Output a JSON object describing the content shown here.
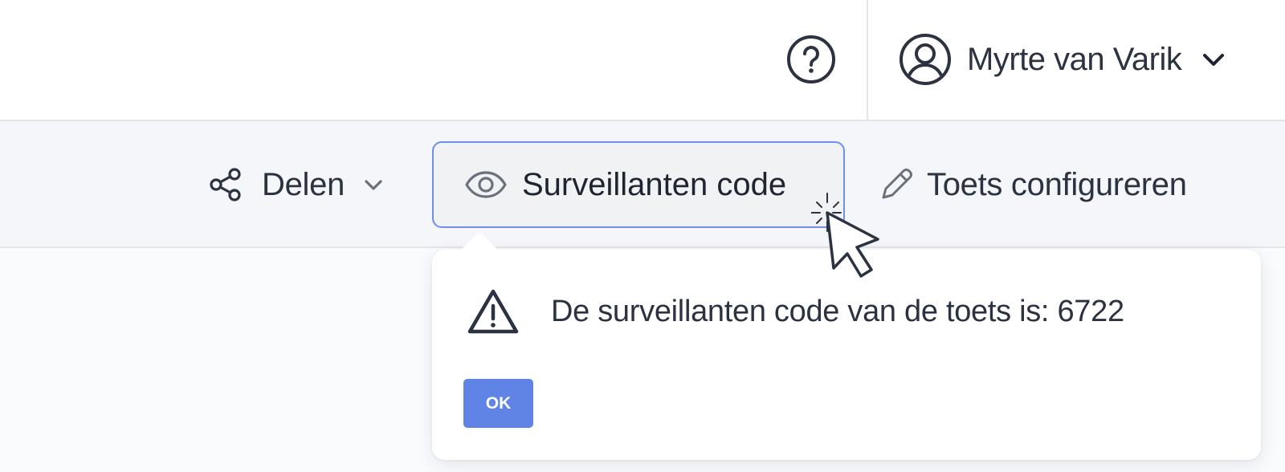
{
  "header": {
    "help_icon": "question-circle-icon",
    "user": {
      "name": "Myrte van Varik",
      "avatar_icon": "user-circle-icon",
      "dropdown_icon": "chevron-down-icon"
    }
  },
  "toolbar": {
    "share": {
      "label": "Delen",
      "icon": "share-icon",
      "dropdown_icon": "chevron-down-icon"
    },
    "proctor_code": {
      "label": "Surveillanten code",
      "icon": "eye-icon"
    },
    "configure": {
      "label": "Toets configureren",
      "icon": "pencil-icon"
    }
  },
  "popover": {
    "icon": "warning-triangle-icon",
    "message": "De surveillanten code van de toets is: 6722",
    "ok_label": "OK"
  },
  "colors": {
    "text": "#2b3240",
    "accent": "#5f84e6",
    "focus_border": "#6f8ff0",
    "toolbar_bg": "#f5f6f9",
    "divider": "#e3e5ea"
  }
}
